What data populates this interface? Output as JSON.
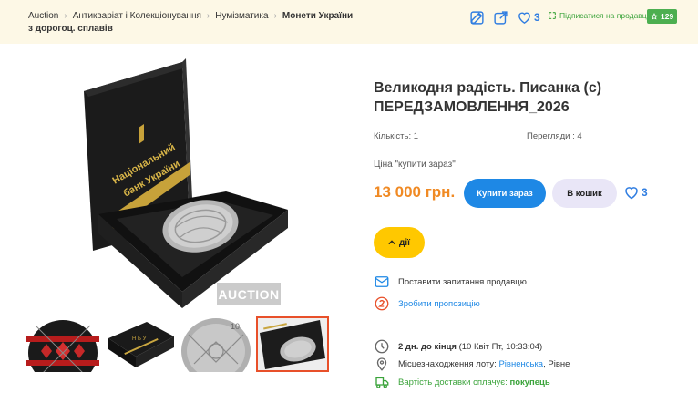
{
  "breadcrumbs": [
    "Auction",
    "Антикваріат і Колекціонування",
    "Нумізматика",
    "Монети України з дорогоц. сплавів"
  ],
  "header": {
    "favorites_count": "3",
    "subscribe_label": "Підписатися на продавця",
    "rating": "129"
  },
  "product": {
    "title": "Великодня радість. Писанка (с) ПЕРЕДЗАМОВЛЕННЯ_2026",
    "quantity": "Кількість: 1",
    "views": "Перегляди : 4",
    "price_caption": "Ціна \"купити зараз\"",
    "price": "13 000 грн.",
    "buy_now_label": "Купити зараз",
    "cart_label": "В кошик",
    "favorites_count": "3",
    "actions_label": "дії",
    "box_text": "Національний банк України",
    "watermark": "AUCTION"
  },
  "links": {
    "ask_seller": "Поставити запитання продавцю",
    "make_offer": "Зробити пропозицію"
  },
  "details": {
    "time_left": "2 дн. до кінця",
    "end_date": "(10 Квіт Пт, 10:33:04)",
    "location_label": "Місцезнаходження лоту:",
    "region": "Рівненська",
    "city": "Рівне",
    "shipping_label": "Вартість доставки сплачує:",
    "shipping_payer": "покупець"
  },
  "icons": [
    "edit-icon",
    "share-icon",
    "heart-icon",
    "subscribe-icon",
    "star-icon",
    "chevron-up-icon",
    "mail-icon",
    "offer-icon",
    "clock-icon",
    "location-icon",
    "delivery-icon"
  ],
  "colors": {
    "topbar_bg": "#fdf8e6",
    "price": "#f08a24",
    "buy_button": "#1e88e5",
    "cart_button": "#e9e6f7",
    "actions_button": "#ffc800",
    "link": "#1e88e5",
    "green": "#3aa33a",
    "thumb_active": "#e8502a"
  }
}
